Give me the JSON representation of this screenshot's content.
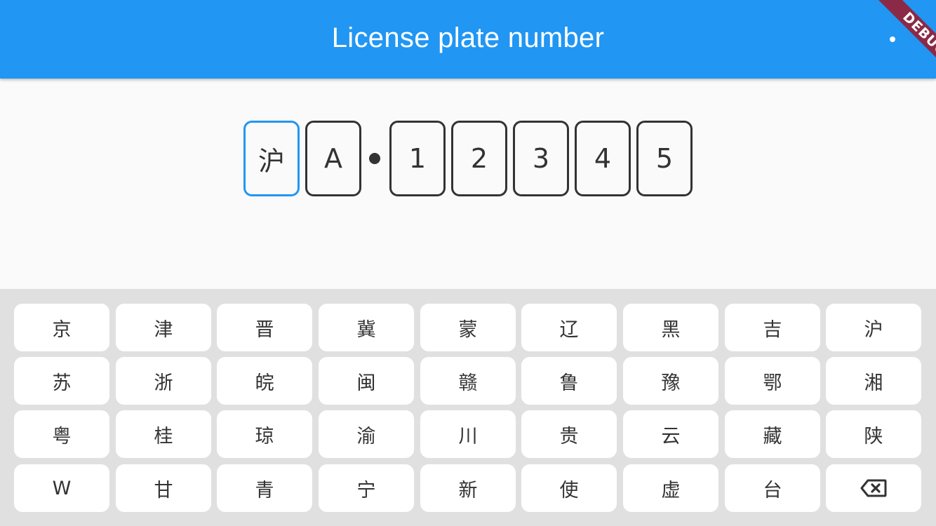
{
  "app_bar": {
    "title": "License plate number",
    "debug_label": "DEBUG",
    "color": "#2196f3"
  },
  "plate": {
    "characters": [
      "沪",
      "A",
      "1",
      "2",
      "3",
      "4",
      "5"
    ],
    "active_index": 0,
    "active_color": "#2196f3"
  },
  "keyboard": {
    "rows": [
      [
        "京",
        "津",
        "晋",
        "冀",
        "蒙",
        "辽",
        "黑",
        "吉",
        "沪"
      ],
      [
        "苏",
        "浙",
        "皖",
        "闽",
        "赣",
        "鲁",
        "豫",
        "鄂",
        "湘"
      ],
      [
        "粤",
        "桂",
        "琼",
        "渝",
        "川",
        "贵",
        "云",
        "藏",
        "陕"
      ],
      [
        "W",
        "甘",
        "青",
        "宁",
        "新",
        "使",
        "虚",
        "台"
      ]
    ],
    "backspace_icon": "backspace-icon"
  }
}
